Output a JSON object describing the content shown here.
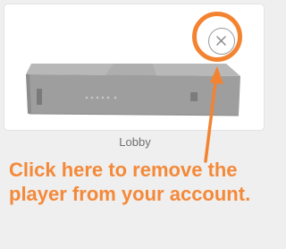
{
  "player": {
    "name": "Lobby",
    "device_image": "sonos-connect-device",
    "remove_icon": "close-icon"
  },
  "annotation": {
    "text": "Click here to remove the player from your account.",
    "color": "#f4893a",
    "arrow_icon": "arrow-icon"
  }
}
